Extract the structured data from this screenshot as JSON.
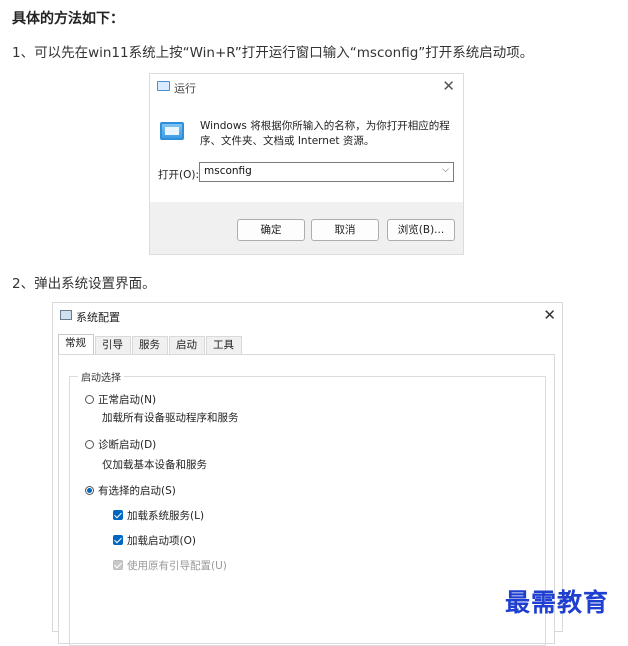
{
  "article": {
    "heading": "具体的方法如下：",
    "step1": "1、可以先在win11系统上按“Win+R”打开运行窗口输入“msconfig”打开系统启动项。",
    "step2": "2、弹出系统设置界面。"
  },
  "run_dialog": {
    "title": "运行",
    "description": "Windows 将根据你所输入的名称，为你打开相应的程序、文件夹、文档或 Internet 资源。",
    "open_label": "打开(O):",
    "open_value": "msconfig",
    "buttons": {
      "ok": "确定",
      "cancel": "取消",
      "browse": "浏览(B)..."
    },
    "icons": {
      "title": "run-icon",
      "body": "run-window-icon",
      "close": "close-icon",
      "dropdown": "chevron-down-icon"
    }
  },
  "config_dialog": {
    "title": "系统配置",
    "tabs": [
      {
        "label": "常规",
        "active": true
      },
      {
        "label": "引导",
        "active": false
      },
      {
        "label": "服务",
        "active": false
      },
      {
        "label": "启动",
        "active": false
      },
      {
        "label": "工具",
        "active": false
      }
    ],
    "group_label": "启动选择",
    "options": {
      "normal": {
        "label": "正常启动(N)",
        "desc": "加载所有设备驱动程序和服务",
        "selected": false
      },
      "diagnostic": {
        "label": "诊断启动(D)",
        "desc": "仅加载基本设备和服务",
        "selected": false
      },
      "selective": {
        "label": "有选择的启动(S)",
        "selected": true
      }
    },
    "checkboxes": {
      "system_services": {
        "label": "加载系统服务(L)",
        "checked": true,
        "enabled": true
      },
      "startup_items": {
        "label": "加载启动项(O)",
        "checked": true,
        "enabled": true
      },
      "original_boot": {
        "label": "使用原有引导配置(U)",
        "checked": true,
        "enabled": false
      }
    },
    "accent_color": "#0067c0"
  },
  "watermark": "最需教育"
}
